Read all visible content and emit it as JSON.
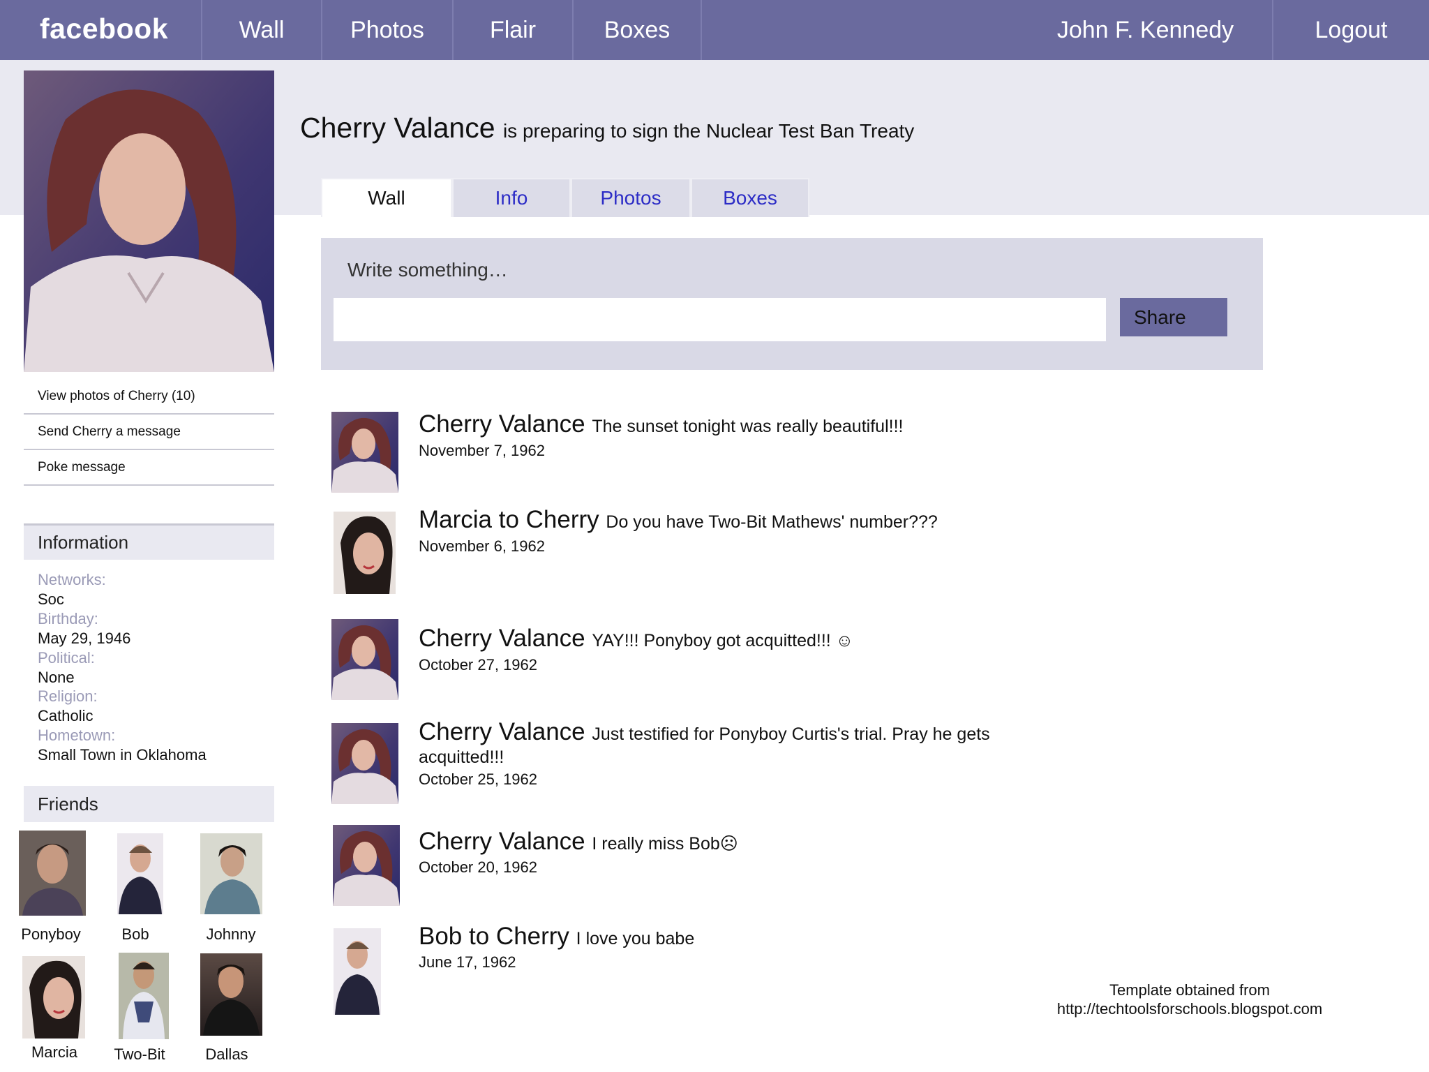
{
  "nav": {
    "logo": "facebook",
    "items": [
      "Wall",
      "Photos",
      "Flair",
      "Boxes"
    ],
    "user": "John F. Kennedy",
    "logout": "Logout"
  },
  "profile": {
    "name": "Cherry Valance",
    "status": "is preparing to sign the Nuclear Test Ban Treaty",
    "tabs": [
      "Wall",
      "Info",
      "Photos",
      "Boxes"
    ],
    "active_tab": "Wall"
  },
  "sidebar": {
    "links": [
      "View photos of Cherry (10)",
      "Send Cherry a message",
      "Poke message"
    ],
    "information_title": "Information",
    "info": [
      {
        "label": "Networks:",
        "value": "Soc"
      },
      {
        "label": "Birthday:",
        "value": "May 29, 1946"
      },
      {
        "label": "Political:",
        "value": "None"
      },
      {
        "label": "Religion:",
        "value": "Catholic"
      },
      {
        "label": "Hometown:",
        "value": "Small Town in Oklahoma"
      }
    ],
    "friends_title": "Friends",
    "friends": [
      "Ponyboy",
      "Bob",
      "Johnny",
      "Marcia",
      "Two-Bit",
      "Dallas"
    ]
  },
  "composer": {
    "label": "Write something…",
    "value": "",
    "share": "Share"
  },
  "posts": [
    {
      "author": "Cherry Valance",
      "message": "The sunset tonight was really beautiful!!!",
      "date": "November 7, 1962"
    },
    {
      "author": "Marcia to Cherry",
      "message": "Do you have Two-Bit Mathews' number???",
      "date": "November 6, 1962"
    },
    {
      "author": "Cherry Valance",
      "message": "YAY!!! Ponyboy got acquitted!!! ☺",
      "date": "October 27, 1962"
    },
    {
      "author": "Cherry Valance",
      "message": "Just testified for Ponyboy Curtis's trial. Pray he gets acquitted!!!",
      "date": "October 25, 1962"
    },
    {
      "author": "Cherry Valance",
      "message": "I really miss Bob☹",
      "date": "October 20, 1962"
    },
    {
      "author": "Bob to Cherry",
      "message": "I love you babe",
      "date": "June 17, 1962"
    }
  ],
  "credit": {
    "line1": "Template obtained from",
    "line2": "http://techtoolsforschools.blogspot.com"
  },
  "colors": {
    "nav_bg": "#6a6a9e",
    "band_bg": "#e9e9f1",
    "composer_bg": "#d9d9e6",
    "tab_link": "#2c2cc6",
    "label_muted": "#9a9ab6"
  }
}
